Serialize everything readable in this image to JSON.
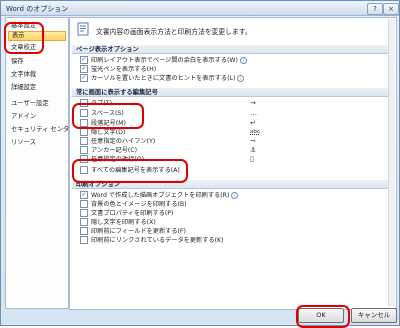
{
  "window": {
    "title": "Word のオプション",
    "help": "?",
    "close": "×"
  },
  "sidebar": {
    "items": [
      {
        "label": "基本設定"
      },
      {
        "label": "表示"
      },
      {
        "label": "文章校正"
      },
      {
        "label": "保存"
      },
      {
        "label": "文字体裁"
      },
      {
        "label": "詳細設定"
      },
      {
        "label": "ユーザー設定"
      },
      {
        "label": "アドイン"
      },
      {
        "label": "セキュリティ センター"
      },
      {
        "label": "リソース"
      }
    ]
  },
  "main": {
    "header_text": "文書内容の画面表示方法と印刷方法を変更します。",
    "sections": [
      {
        "title": "ページ表示オプション"
      },
      {
        "title": "常に画面に表示する編集記号"
      },
      {
        "title": "印刷オプション"
      }
    ],
    "page_options": [
      {
        "label": "印刷レイアウト表示でページ間の余白を表示する(W)",
        "checked": "✓"
      },
      {
        "label": "蛍光ペンを表示する(H)",
        "checked": "✓"
      },
      {
        "label": "カーソルを置いたときに文書のヒントを表示する(L)",
        "checked": "✓"
      }
    ],
    "marks": [
      {
        "label": "タブ(T)",
        "glyph": "→"
      },
      {
        "label": "スペース(S)",
        "glyph": "…"
      },
      {
        "label": "段落記号(M)",
        "glyph": "↵"
      },
      {
        "label": "隠し文字(D)",
        "glyph": "abc"
      },
      {
        "label": "任意指定のハイフン(Y)",
        "glyph": "¬"
      },
      {
        "label": "アンカー記号(C)",
        "glyph": "⚓"
      },
      {
        "label": "任意指定の改行(O)",
        "glyph": "▯"
      },
      {
        "label": "すべての編集記号を表示する(A)",
        "glyph": ""
      }
    ],
    "print_options": [
      {
        "label": "Word で作成した描画オブジェクトを印刷する(R)",
        "checked": "✓"
      },
      {
        "label": "背景の色とイメージを印刷する(B)",
        "checked": ""
      },
      {
        "label": "文書プロパティを印刷する(P)",
        "checked": ""
      },
      {
        "label": "隠し文字を印刷する(X)",
        "checked": ""
      },
      {
        "label": "印刷前にフィールドを更新する(F)",
        "checked": ""
      },
      {
        "label": "印刷前にリンクされているデータを更新する(K)",
        "checked": ""
      }
    ]
  },
  "buttons": {
    "ok": "OK",
    "cancel": "キャンセル"
  }
}
